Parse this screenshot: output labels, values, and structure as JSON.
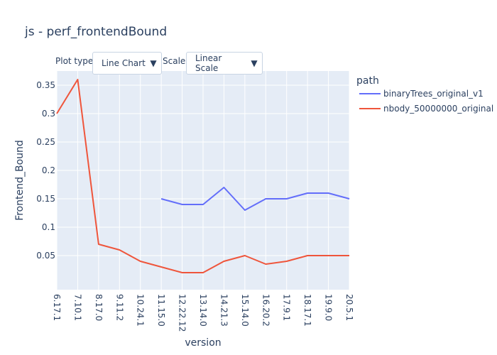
{
  "title": "js - perf_frontendBound",
  "controls": {
    "plot_type_label": "Plot type:",
    "plot_type_value": "Line Chart",
    "scale_label": "Scale:",
    "scale_value": "Linear Scale",
    "arrow_glyph": "▼"
  },
  "chart_data": {
    "type": "line",
    "title": "js - perf_frontendBound",
    "xlabel": "version",
    "ylabel": "Frontend_Bound",
    "ylim": [
      -0.01,
      0.375
    ],
    "y_ticks": [
      0.05,
      0.1,
      0.15,
      0.2,
      0.25,
      0.3,
      0.35
    ],
    "y_tick_labels": [
      "0.05",
      "0.1",
      "0.15",
      "0.2",
      "0.25",
      "0.3",
      "0.35"
    ],
    "grid": true,
    "legend_title": "path",
    "legend_position": "right",
    "categories": [
      "6.17.1",
      "7.10.1",
      "8.17.0",
      "9.11.2",
      "10.24.1",
      "11.15.0",
      "12.22.12",
      "13.14.0",
      "14.21.3",
      "15.14.0",
      "16.20.2",
      "17.9.1",
      "18.17.1",
      "19.9.0",
      "20.5.1"
    ],
    "series": [
      {
        "name": "binaryTrees_original_v1",
        "color": "#636efa",
        "values": [
          null,
          null,
          null,
          null,
          null,
          0.15,
          0.14,
          0.14,
          0.17,
          0.13,
          0.15,
          0.15,
          0.16,
          0.16,
          0.15
        ]
      },
      {
        "name": "nbody_50000000_original",
        "color": "#ef553b",
        "values": [
          0.3,
          0.36,
          0.07,
          0.06,
          0.04,
          0.03,
          0.02,
          0.02,
          0.04,
          0.05,
          0.035,
          0.04,
          0.05,
          0.05,
          0.05
        ]
      }
    ]
  }
}
